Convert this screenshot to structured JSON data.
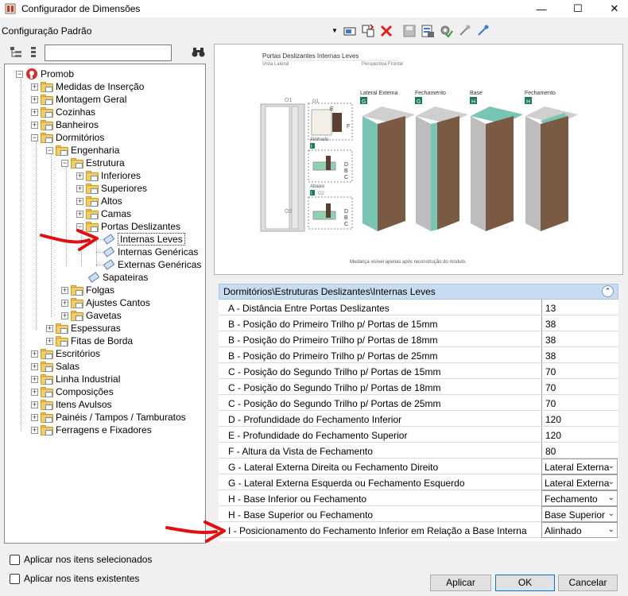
{
  "window": {
    "title": "Configurador de Dimensões"
  },
  "config": {
    "selected": "Configuração Padrão"
  },
  "tree": {
    "root": "Promob",
    "items": [
      "Medidas de Inserção",
      "Montagem Geral",
      "Cozinhas",
      "Banheiros",
      "Dormitórios",
      "Engenharia",
      "Estrutura",
      "Inferiores",
      "Superiores",
      "Altos",
      "Camas",
      "Portas Deslizantes",
      "Internas Leves",
      "Internas Genéricas",
      "Externas Genéricas",
      "Sapateiras",
      "Folgas",
      "Ajustes Cantos",
      "Gavetas",
      "Espessuras",
      "Fitas de Borda",
      "Escritórios",
      "Salas",
      "Linha Industrial",
      "Composições",
      "Itens Avulsos",
      "Painéis / Tampos / Tamburatos",
      "Ferragens e Fixadores"
    ]
  },
  "preview": {
    "heading": "Portas Deslizantes Internas Leves",
    "side_view": "Vista Lateral",
    "front_view": "Perspectiva Frontal",
    "o1": "O1",
    "o2": "O2",
    "alinhado": "Alinhado",
    "abaixo": "Abaixo",
    "marks": {
      "e": "E",
      "f": "F",
      "d": "D",
      "b": "B",
      "c": "C",
      "i": "I"
    },
    "cabinets": [
      {
        "label": "Lateral Externa",
        "letter": "G"
      },
      {
        "label": "Fechamento",
        "letter": "G"
      },
      {
        "label": "Base",
        "letter": "H"
      },
      {
        "label": "Fechamento",
        "letter": "H"
      }
    ],
    "note": "Mudança visível apenas após reconstrução do módulo."
  },
  "properties": {
    "path": "Dormitórios\\Estruturas Deslizantes\\Internas Leves",
    "rows": [
      {
        "label": "A - Distância Entre Portas Deslizantes",
        "value": "13"
      },
      {
        "label": "B - Posição do Primeiro Trilho p/ Portas de 15mm",
        "value": "38"
      },
      {
        "label": "B - Posição do Primeiro Trilho p/ Portas de 18mm",
        "value": "38"
      },
      {
        "label": "B - Posição do Primeiro Trilho p/ Portas de 25mm",
        "value": "38"
      },
      {
        "label": "C - Posição do Segundo Trilho p/ Portas de 15mm",
        "value": "70"
      },
      {
        "label": "C - Posição do Segundo Trilho p/ Portas de 18mm",
        "value": "70"
      },
      {
        "label": "C - Posição do Segundo Trilho p/ Portas de 25mm",
        "value": "70"
      },
      {
        "label": "D - Profundidade do Fechamento Inferior",
        "value": "120"
      },
      {
        "label": "E - Profundidade do Fechamento Superior",
        "value": "120"
      },
      {
        "label": "F - Altura da Vista de Fechamento",
        "value": "80"
      },
      {
        "label": "G - Lateral Externa Direita ou Fechamento Direito",
        "value": "Lateral Externa"
      },
      {
        "label": "G - Lateral Externa Esquerda ou Fechamento Esquerdo",
        "value": "Lateral Externa"
      },
      {
        "label": "H - Base Inferior ou Fechamento",
        "value": "Fechamento"
      },
      {
        "label": "H - Base Superior ou Fechamento",
        "value": "Base Superior"
      },
      {
        "label": "I - Posicionamento do Fechamento Inferior em Relação a Base Interna",
        "value": "Alinhado"
      }
    ]
  },
  "options": {
    "apply_selected": "Aplicar nos itens selecionados",
    "apply_existing": "Aplicar nos itens existentes"
  },
  "buttons": {
    "apply": "Aplicar",
    "ok": "OK",
    "cancel": "Cancelar"
  },
  "colors": {
    "accent": "#0078d7",
    "annotation_arrow": "#e01010",
    "panel_teal": "#79c5b4",
    "wood": "#7a5a43"
  }
}
